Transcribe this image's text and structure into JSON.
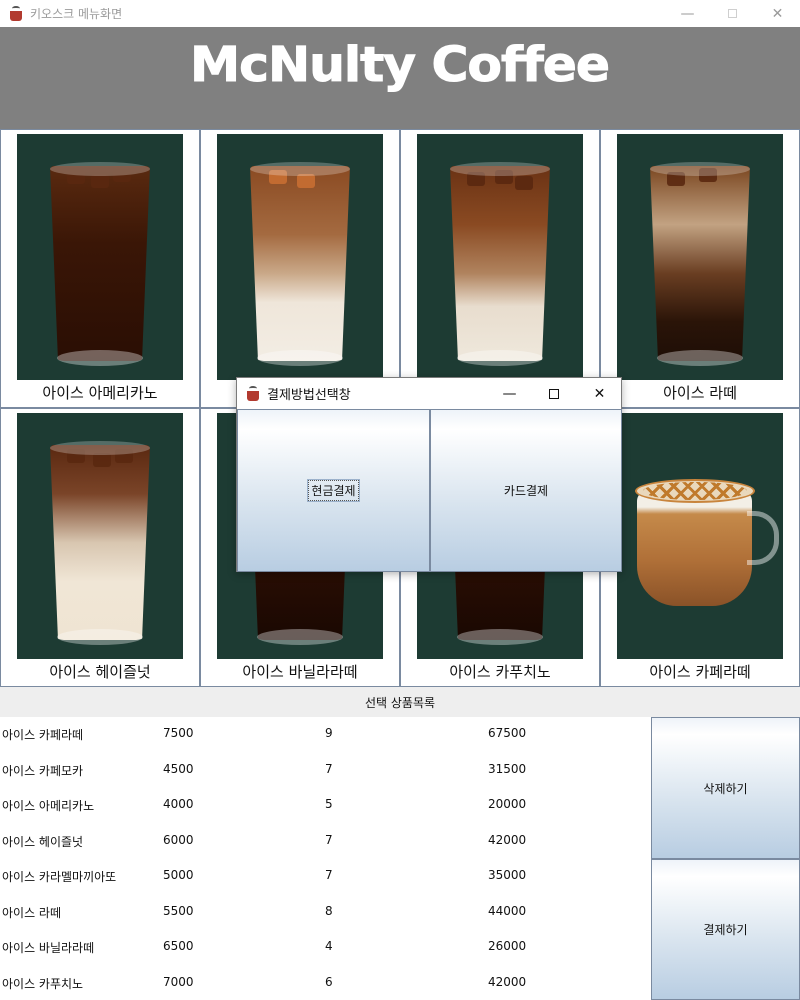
{
  "window": {
    "title": "키오스크 메뉴화면",
    "minimize": "—",
    "close": "✕"
  },
  "header": {
    "title": "McNulty Coffee"
  },
  "menu": [
    {
      "label": "아이스 아메리카노",
      "icon": "iced-americano-image"
    },
    {
      "label": "",
      "icon": "iced-latte-image"
    },
    {
      "label": "",
      "icon": "iced-latte-image"
    },
    {
      "label": "아이스 라떼",
      "icon": "iced-latte-image"
    },
    {
      "label": "아이스 헤이즐넛",
      "icon": "iced-hazelnut-image"
    },
    {
      "label": "아이스 바닐라라떼",
      "icon": "iced-vanilla-latte-image"
    },
    {
      "label": "아이스 카푸치노",
      "icon": "iced-cappuccino-image"
    },
    {
      "label": "아이스 카페라떼",
      "icon": "caramel-macchiato-image"
    }
  ],
  "dialog": {
    "title": "결제방법선택창",
    "minimize": "—",
    "close": "✕",
    "cash_label": "현금결제",
    "card_label": "카드결제"
  },
  "selection": {
    "header": "선택 상품목록",
    "rows": [
      {
        "name": "아이스 카페라떼",
        "price": "7500",
        "qty": "9",
        "total": "67500"
      },
      {
        "name": "아이스 카페모카",
        "price": "4500",
        "qty": "7",
        "total": "31500"
      },
      {
        "name": "아이스 아메리카노",
        "price": "4000",
        "qty": "5",
        "total": "20000"
      },
      {
        "name": "아이스 헤이즐넛",
        "price": "6000",
        "qty": "7",
        "total": "42000"
      },
      {
        "name": "아이스 카라멜마끼아또",
        "price": "5000",
        "qty": "7",
        "total": "35000"
      },
      {
        "name": "아이스 라떼",
        "price": "5500",
        "qty": "8",
        "total": "44000"
      },
      {
        "name": "아이스 바닐라라떼",
        "price": "6500",
        "qty": "4",
        "total": "26000"
      },
      {
        "name": "아이스 카푸치노",
        "price": "7000",
        "qty": "6",
        "total": "42000"
      }
    ],
    "delete_label": "삭제하기",
    "pay_label": "결제하기"
  }
}
